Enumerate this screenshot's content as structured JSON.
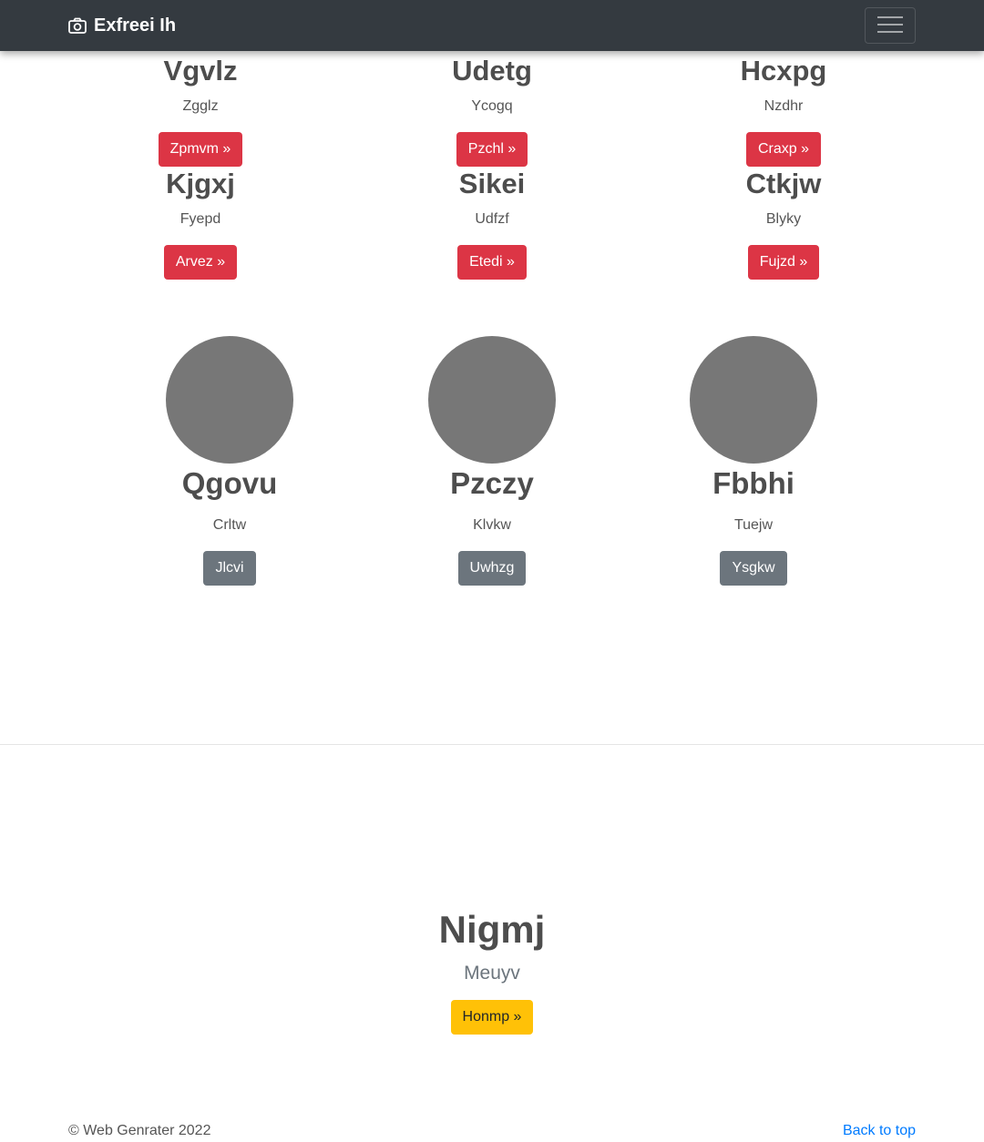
{
  "navbar": {
    "brand": "Exfreei Ih",
    "brand_icon": "camera-icon",
    "toggler_icon": "hamburger-menu-icon"
  },
  "cards": [
    {
      "title": "Vgvlz",
      "subtitle": "Zgglz",
      "button": "Zpmvm »"
    },
    {
      "title": "Udetg",
      "subtitle": "Ycogq",
      "button": "Pzchl »"
    },
    {
      "title": "Hcxpg",
      "subtitle": "Nzdhr",
      "button": "Craxp »"
    },
    {
      "title": "Kjgxj",
      "subtitle": "Fyepd",
      "button": "Arvez »"
    },
    {
      "title": "Sikei",
      "subtitle": "Udfzf",
      "button": "Etedi »"
    },
    {
      "title": "Ctkjw",
      "subtitle": "Blyky",
      "button": "Fujzd »"
    }
  ],
  "marketing": [
    {
      "title": "Qgovu",
      "subtitle": "Crltw",
      "button": "Jlcvi"
    },
    {
      "title": "Pzczy",
      "subtitle": "Klvkw",
      "button": "Uwhzg"
    },
    {
      "title": "Fbbhi",
      "subtitle": "Tuejw",
      "button": "Ysgkw"
    }
  ],
  "feature": {
    "title": "Nigmj",
    "subtitle": "Meuyv",
    "button": "Honmp »"
  },
  "footer": {
    "copyright": "© Web Genrater 2022",
    "back_to_top": "Back to top"
  },
  "colors": {
    "navbar_bg": "#343a40",
    "danger": "#dc3545",
    "secondary": "#6c757d",
    "warning": "#ffc107",
    "link": "#007bff",
    "placeholder_circle": "#777777"
  }
}
